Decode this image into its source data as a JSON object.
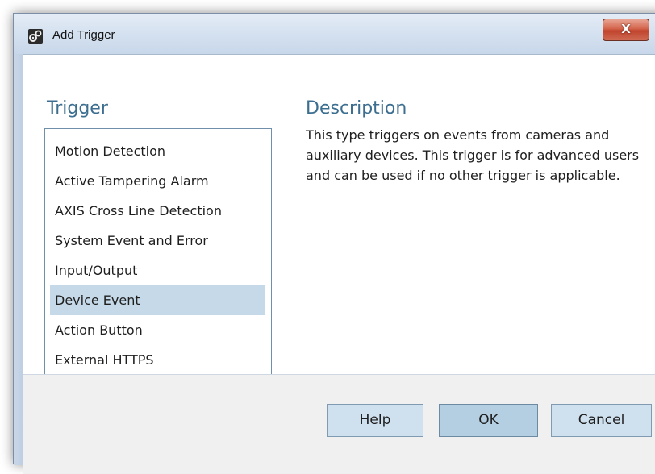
{
  "window": {
    "title": "Add Trigger",
    "close_label": "X"
  },
  "left": {
    "heading": "Trigger",
    "items": [
      {
        "label": "Motion Detection",
        "selected": false
      },
      {
        "label": "Active Tampering Alarm",
        "selected": false
      },
      {
        "label": "AXIS Cross Line Detection",
        "selected": false
      },
      {
        "label": "System Event and Error",
        "selected": false
      },
      {
        "label": "Input/Output",
        "selected": false
      },
      {
        "label": "Device Event",
        "selected": true
      },
      {
        "label": "Action Button",
        "selected": false
      },
      {
        "label": "External HTTPS",
        "selected": false
      }
    ]
  },
  "right": {
    "heading": "Description",
    "text": "This type triggers on events from cameras and auxiliary devices. This trigger is for advanced users and can be used if no other trigger is applicable."
  },
  "footer": {
    "help_label": "Help",
    "ok_label": "OK",
    "cancel_label": "Cancel"
  },
  "colors": {
    "heading": "#3c6e8f",
    "selection": "#c5d9e8",
    "close": "#c0432c"
  }
}
